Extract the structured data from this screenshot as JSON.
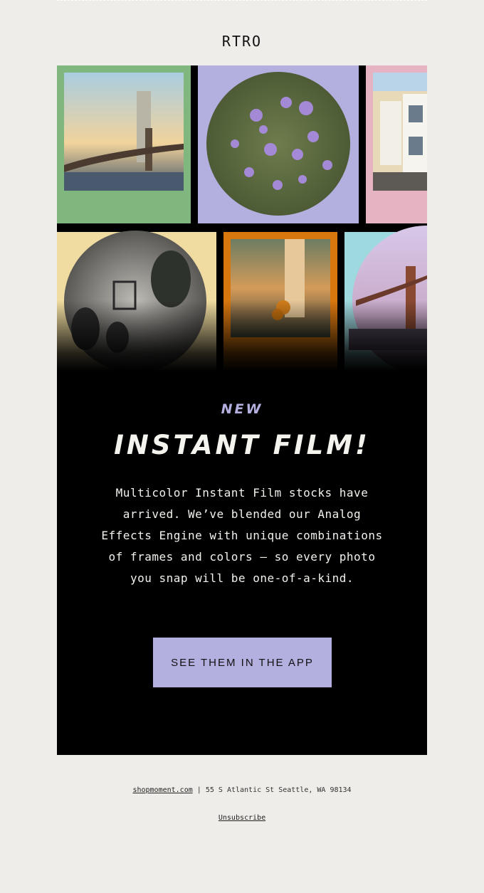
{
  "brand": {
    "logo": "RTRO"
  },
  "hero": {
    "tag": "NEW",
    "headline": "INSTANT FILM!",
    "body": "Multicolor Instant Film stocks have arrived. We’ve blended our Analog Effects Engine with unique combinations of frames and colors – so every photo you snap will be one-of-a-kind.",
    "cta_label": "SEE THEM IN THE APP"
  },
  "footer": {
    "site_link": "shopmoment.com",
    "separator": "|",
    "address": "55 S Atlantic St Seattle, WA 98134",
    "unsubscribe": "Unsubscribe"
  },
  "colors": {
    "page_bg": "#eeede9",
    "card_bg": "#000000",
    "accent_lavender": "#b3b0e0",
    "frame_green": "#7fb77e",
    "frame_pink": "#e6b3c2",
    "frame_yellow": "#f0dca0",
    "frame_orange": "#d9770f",
    "frame_cyan": "#9fd9e0"
  }
}
